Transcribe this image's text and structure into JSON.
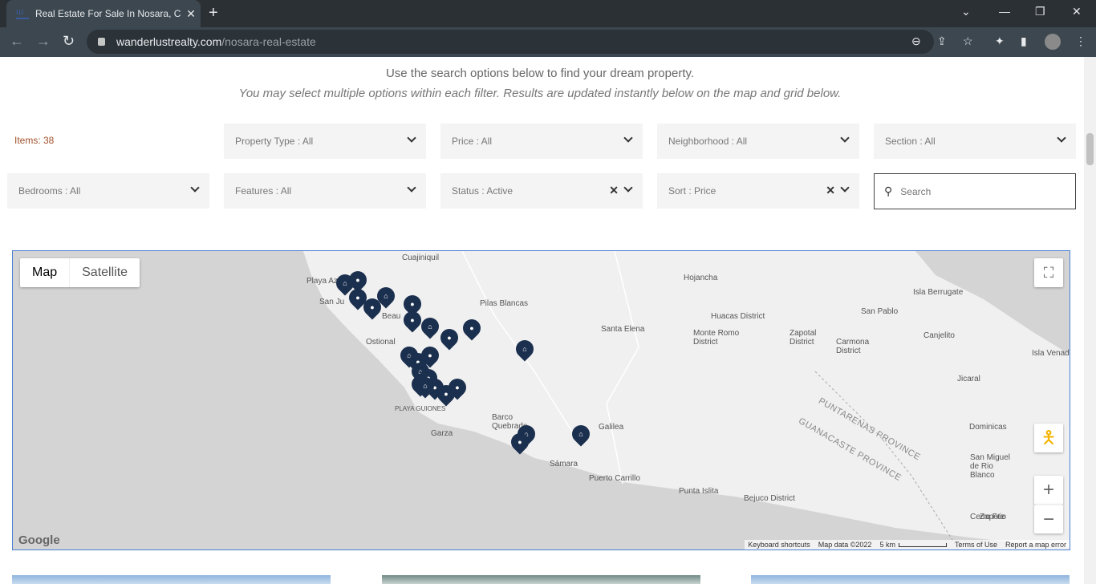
{
  "browser": {
    "tab_title": "Real Estate For Sale In Nosara, Co",
    "url_domain": "wanderlustrealty.com",
    "url_path": "/nosara-real-estate"
  },
  "intro": {
    "line1": "Use the search options below to find your dream property.",
    "line2": "You may select multiple options within each filter. Results are updated instantly below on the map and grid below."
  },
  "items_count": "Items: 38",
  "filters": {
    "row1": [
      "Property Type : All",
      "Price : All",
      "Neighborhood : All",
      "Section : All"
    ],
    "row2": [
      "Bedrooms : All",
      "Features : All",
      "Status : Active",
      "Sort : Price"
    ],
    "search_placeholder": "Search"
  },
  "map": {
    "type_buttons": [
      "Map",
      "Satellite"
    ],
    "places": [
      "Cuajiniquil",
      "Playa Az",
      "San Ju",
      "Hojancha",
      "Pilas Blancas",
      "Ostional",
      "Huacas District",
      "Santa Elena",
      "Monte Romo District",
      "Zapotal District",
      "Carmona District",
      "San Pablo",
      "Isla Berrugate",
      "Canjelito",
      "Isla Venad",
      "Jicaral",
      "PLAYA GUIONES",
      "Garza",
      "Barco Quebrado",
      "Sámara",
      "Galilea",
      "Puerto Carrillo",
      "Punta Islita",
      "Bejuco District",
      "Dominicas",
      "San Miguel de Rio Blanco",
      "Zapote",
      "Cerro Frio",
      "Beau"
    ],
    "provinces": [
      "PUNTARENAS PROVINCE",
      "GUANACASTE PROVINCE"
    ],
    "footer": {
      "shortcuts": "Keyboard shortcuts",
      "mapdata": "Map data ©2022",
      "scale": "5 km",
      "terms": "Terms of Use",
      "report": "Report a map error"
    },
    "logo": "Google",
    "marker_color": "#1b2f4e"
  }
}
